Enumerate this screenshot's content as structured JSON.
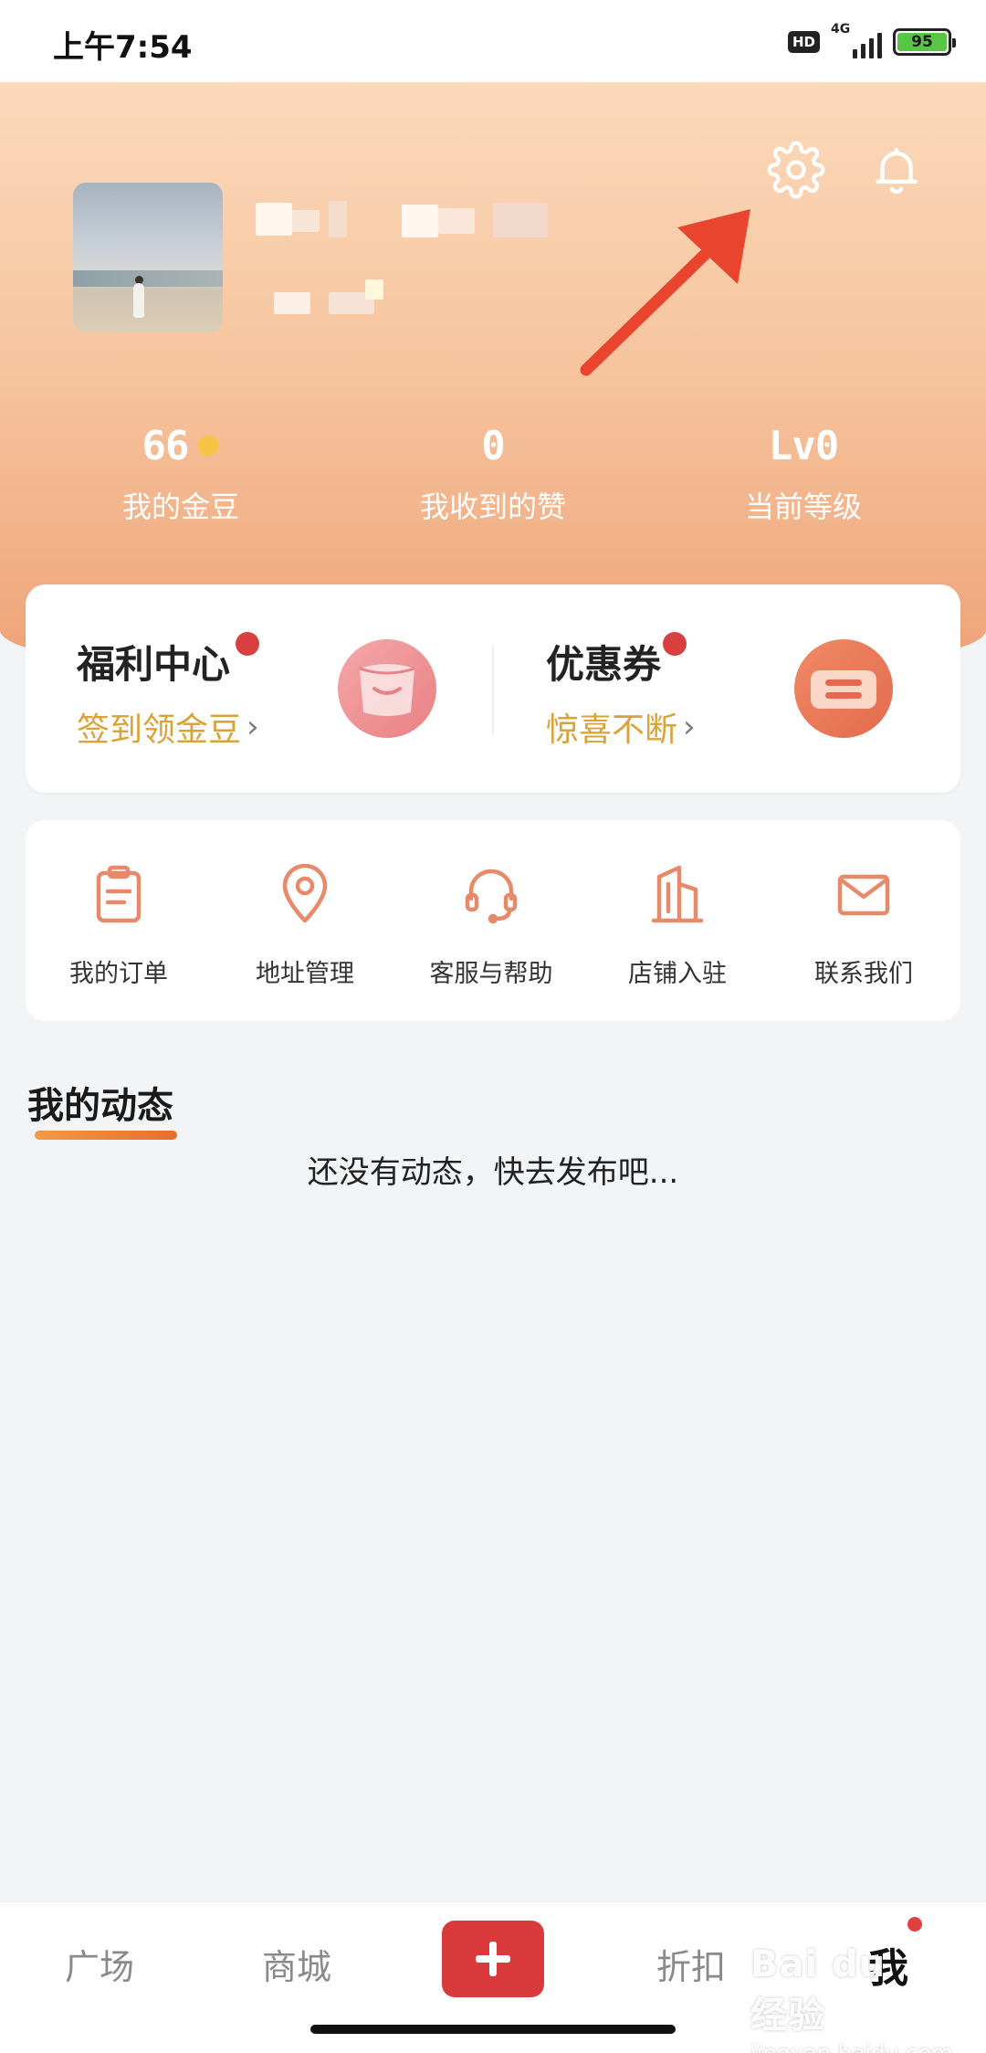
{
  "status_bar": {
    "time": "上午7:54",
    "hd": "HD",
    "network": "4G",
    "battery": "95",
    "battery_level": 0.95
  },
  "header": {
    "settings_icon": "gear-icon",
    "bell_icon": "bell-icon",
    "stats": [
      {
        "value": "66",
        "label": "我的金豆",
        "icon": "coin-icon"
      },
      {
        "value": "0",
        "label": "我收到的赞"
      },
      {
        "value": "Lv0",
        "label": "当前等级"
      }
    ]
  },
  "welfare": {
    "left": {
      "title": "福利中心",
      "subtitle": "签到领金豆",
      "arrow": "›",
      "icon": "gift-bag-icon"
    },
    "right": {
      "title": "优惠券",
      "subtitle": "惊喜不断",
      "arrow": "›",
      "icon": "coupon-icon"
    }
  },
  "services": [
    {
      "label": "我的订单",
      "icon": "clipboard-icon"
    },
    {
      "label": "地址管理",
      "icon": "location-pin-icon"
    },
    {
      "label": "客服与帮助",
      "icon": "headset-icon"
    },
    {
      "label": "店铺入驻",
      "icon": "building-icon"
    },
    {
      "label": "联系我们",
      "icon": "mail-icon"
    }
  ],
  "activity": {
    "title": "我的动态",
    "empty": "还没有动态，快去发布吧..."
  },
  "bottom_nav": {
    "items": [
      "广场",
      "商城",
      "折扣",
      "我"
    ],
    "active": "我",
    "plus_icon": "plus-icon"
  },
  "watermark": {
    "logo": "Bai du 经验",
    "url": "jingyan.baidu.com"
  },
  "colors": {
    "accent_red": "#d93a3b",
    "gold": "#d9a33a",
    "header_orange": "#eea177",
    "icon_orange": "#e88a6a"
  }
}
